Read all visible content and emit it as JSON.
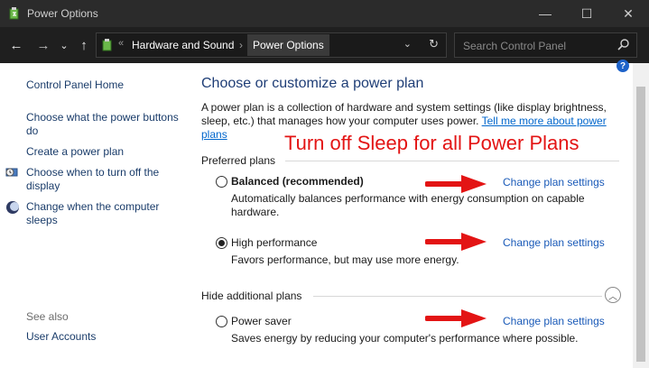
{
  "window": {
    "title": "Power Options",
    "controls": {
      "minimize": "—",
      "maximize": "☐",
      "close": "✕"
    }
  },
  "address_bar": {
    "back": "←",
    "forward": "→",
    "recent": "⌄",
    "up": "↑",
    "separator": "«",
    "breadcrumbs": [
      {
        "label": "Hardware and Sound"
      },
      {
        "label": "Power Options"
      }
    ],
    "crumb_separator": "›",
    "dropdown": "⌄",
    "refresh": "↻",
    "search_placeholder": "Search Control Panel"
  },
  "left_pane": {
    "links": [
      {
        "label": "Control Panel Home"
      },
      {
        "label": "Choose what the power buttons do"
      },
      {
        "label": "Create a power plan"
      },
      {
        "label": "Choose when to turn off the display",
        "icon": "display-clock-icon"
      },
      {
        "label": "Change when the computer sleeps",
        "icon": "moon-icon"
      }
    ],
    "see_also_label": "See also",
    "see_also_links": [
      {
        "label": "User Accounts"
      }
    ]
  },
  "main": {
    "heading": "Choose or customize a power plan",
    "description": "A power plan is a collection of hardware and system settings (like display brightness, sleep, etc.) that manages how your computer uses power.",
    "learn_more": "Tell me more about power plans",
    "annotation": "Turn off Sleep for all Power Plans",
    "preferred_label": "Preferred plans",
    "hidden_label": "Hide additional plans",
    "collapse_glyph": "︿",
    "help_glyph": "?",
    "change_label": "Change plan settings",
    "plans": [
      {
        "name": "Balanced (recommended)",
        "selected": false,
        "description": "Automatically balances performance with energy consumption on capable hardware."
      },
      {
        "name": "High performance",
        "selected": true,
        "description": "Favors performance, but may use more energy."
      },
      {
        "name": "Power saver",
        "selected": false,
        "description": "Saves energy by reducing your computer's performance where possible."
      }
    ]
  },
  "colors": {
    "titlebar": "#2b2b2b",
    "addressbar": "#1f1f1f",
    "link": "#1a5ab8",
    "heading": "#1e3d76",
    "annotation": "#e31414"
  }
}
